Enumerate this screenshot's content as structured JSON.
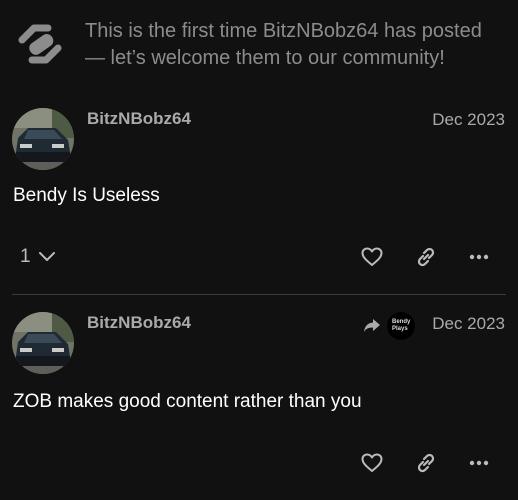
{
  "notice": {
    "text": "This is the first time BitzNBobz64 has posted — let’s welcome them to our community!",
    "icon": "handshake-icon"
  },
  "posts": [
    {
      "username": "BitzNBobz64",
      "date": "Dec 2023",
      "body": "Bendy Is Useless",
      "reply_count": "1",
      "actions": [
        "heart-icon",
        "link-icon",
        "more-icon"
      ]
    },
    {
      "username": "BitzNBobz64",
      "date": "Dec 2023",
      "body": "ZOB makes good content rather than you",
      "reply_to": {
        "avatar_line1": "Bendy",
        "avatar_line2": "Plays"
      },
      "actions": [
        "heart-icon",
        "link-icon",
        "more-icon"
      ]
    }
  ],
  "colors": {
    "background": "#111111",
    "muted_text": "#8c8c8c",
    "meta_text": "#aaaaaa",
    "body_text": "#ffffff"
  }
}
